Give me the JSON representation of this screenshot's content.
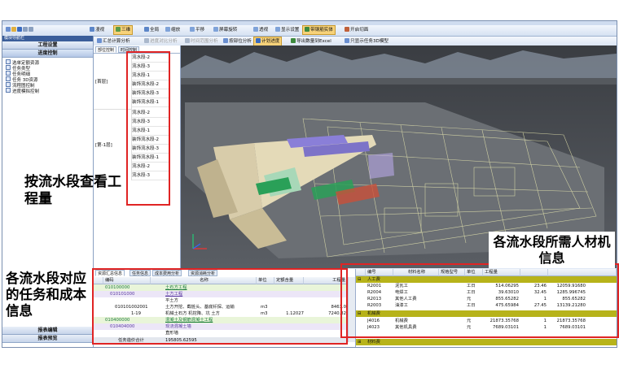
{
  "toolbar": {
    "items": [
      {
        "label": "漫视",
        "on": false
      },
      {
        "label": "三维",
        "on": true
      },
      {
        "label": "全局",
        "on": false
      },
      {
        "label": "缩放",
        "on": false
      },
      {
        "label": "平移",
        "on": false
      },
      {
        "label": "屏幕旋转",
        "on": false
      },
      {
        "label": "透视",
        "on": false
      },
      {
        "label": "显示设置",
        "on": false
      },
      {
        "label": "带钢筋实体",
        "on": true
      },
      {
        "label": "开启切面",
        "on": false
      }
    ]
  },
  "subtoolbar": {
    "items": [
      {
        "label": "汇总计算分析",
        "on": false
      },
      {
        "label": "进度对比分析",
        "on": false
      },
      {
        "label": "时间范围分析",
        "on": false
      },
      {
        "label": "按部位分析",
        "on": false
      },
      {
        "label": "计划进度",
        "on": true
      },
      {
        "label": "导出数量到Excel",
        "on": false
      },
      {
        "label": "只显示任务3D模型",
        "on": false
      }
    ]
  },
  "left_panel": {
    "title": "模块导航栏",
    "section1": "工程设置",
    "section2": "进度控制",
    "items": [
      "选单定额资源",
      "任务类型",
      "任务明细",
      "任务 3D资源",
      "流程图控制",
      "进度模拟控制"
    ],
    "section3": "报表编辑",
    "section4": "报表预览"
  },
  "mid_panel": {
    "tabs": [
      "部位控制",
      "时间控制"
    ],
    "groups": [
      {
        "name": "[首层]",
        "rows": [
          "流水段-2",
          "流水段-3",
          "流水段-1",
          "装饰流水段-2",
          "装饰流水段-3",
          "装饰流水段-1"
        ]
      },
      {
        "name": "[第-1层]",
        "rows": [
          "流水段-2",
          "流水段-3",
          "流水段-1",
          "装饰流水段-2",
          "装饰流水段-3",
          "装饰流水段-1",
          "流水段-2",
          "流水段-3"
        ]
      }
    ]
  },
  "bottom_panel": {
    "tabs": [
      "资源汇总信息",
      "任务信息",
      "成本费用分析",
      "资源消耗分析"
    ],
    "columns": [
      "",
      "编码",
      "名称",
      "单位",
      "定额含量",
      "工程量"
    ],
    "rows": [
      {
        "code": "010100000",
        "name": "土石方工程",
        "unit": "",
        "qty": "",
        "amt": "",
        "style": "green"
      },
      {
        "code": "010101000",
        "name": "土方工程",
        "unit": "",
        "qty": "",
        "amt": "",
        "style": "purple"
      },
      {
        "code": "",
        "name": "平土方",
        "unit": "",
        "qty": "",
        "amt": "",
        "style": "plain"
      },
      {
        "code": "010101002001",
        "name": "土方开挖、截桩头、基底钎探、运输",
        "unit": "m3",
        "qty": "",
        "amt": "8463.0",
        "style": "plain"
      },
      {
        "code": "1-19",
        "name": "机械土石方 机挖降、坑 土方",
        "unit": "m3",
        "qty": "1.12027",
        "amt": "7240.32",
        "style": "plain"
      },
      {
        "code": "010400000",
        "name": "混凝土及钢筋混凝土工程",
        "unit": "",
        "qty": "",
        "amt": "",
        "style": "green"
      },
      {
        "code": "010404000",
        "name": "现浇混凝土墙",
        "unit": "",
        "qty": "",
        "amt": "",
        "style": "purple"
      },
      {
        "code": "",
        "name": "直形墙",
        "unit": "",
        "qty": "",
        "amt": "",
        "style": "plain"
      }
    ],
    "total_label": "任务造价合计",
    "total_value": "195805.62595"
  },
  "resource_panel": {
    "columns": [
      "编号",
      "材料名称",
      "规格型号",
      "单位",
      "工程量",
      "",
      ""
    ],
    "groups": [
      {
        "name": "人工费",
        "rows": [
          {
            "code": "R2001",
            "name": "泥瓦工",
            "spec": "",
            "unit": "工日",
            "q1": "514.06295",
            "q2": "23.46",
            "q3": "12059.91680"
          },
          {
            "code": "R2004",
            "name": "电焊工",
            "spec": "",
            "unit": "工日",
            "q1": "39.63010",
            "q2": "32.45",
            "q3": "1285.996745"
          },
          {
            "code": "R2013",
            "name": "其他人工费",
            "spec": "",
            "unit": "元",
            "q1": "855.65282",
            "q2": "1",
            "q3": "855.65282"
          },
          {
            "code": "R2003",
            "name": "油漆工",
            "spec": "",
            "unit": "工日",
            "q1": "475.65984",
            "q2": "27.45",
            "q3": "13139.21280"
          }
        ]
      },
      {
        "name": "机械费",
        "rows": [
          {
            "code": "J4016",
            "name": "机械费",
            "spec": "",
            "unit": "元",
            "q1": "21873.35768",
            "q2": "1",
            "q3": "21873.35768"
          },
          {
            "code": "J4023",
            "name": "其他机具费",
            "spec": "",
            "unit": "元",
            "q1": "7689.03101",
            "q2": "1",
            "q3": "7689.03101"
          }
        ]
      },
      {
        "name": "材料费",
        "rows": []
      }
    ]
  },
  "captions": {
    "flow_section": "按流水段查看工程量",
    "resources": "各流水段所需人材机信息",
    "tasks_cost": "各流水段对应的任务和成本信息"
  },
  "colors": {
    "annotation": "#e02424",
    "selected_tool": "#f7d27a",
    "group_row": "#b7b31a"
  }
}
